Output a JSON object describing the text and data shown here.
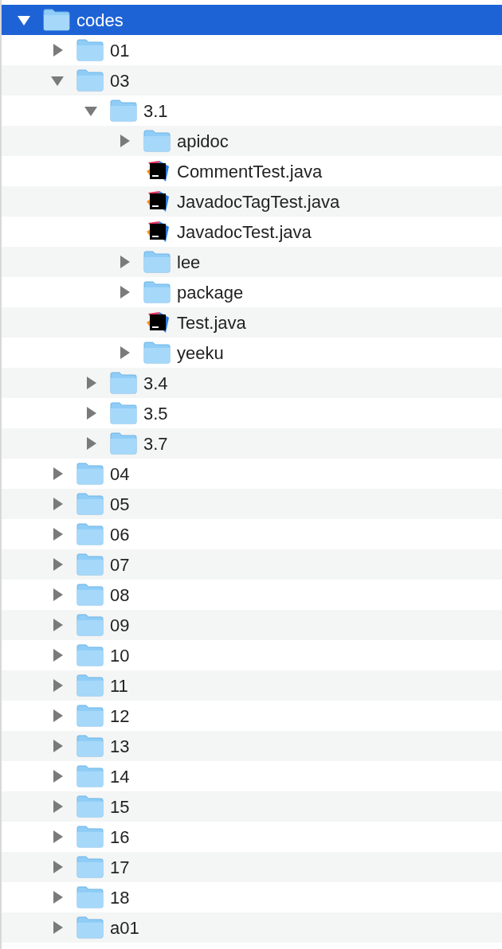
{
  "tree": [
    {
      "name": "codes",
      "kind": "folder",
      "expanded": true,
      "selected": true,
      "children": [
        {
          "name": "01",
          "kind": "folder",
          "expanded": false,
          "selected": false
        },
        {
          "name": "03",
          "kind": "folder",
          "expanded": true,
          "selected": false,
          "children": [
            {
              "name": "3.1",
              "kind": "folder",
              "expanded": true,
              "selected": false,
              "children": [
                {
                  "name": "apidoc",
                  "kind": "folder",
                  "expanded": false,
                  "selected": false
                },
                {
                  "name": "CommentTest.java",
                  "kind": "file",
                  "selected": false
                },
                {
                  "name": "JavadocTagTest.java",
                  "kind": "file",
                  "selected": false
                },
                {
                  "name": "JavadocTest.java",
                  "kind": "file",
                  "selected": false
                },
                {
                  "name": "lee",
                  "kind": "folder",
                  "expanded": false,
                  "selected": false
                },
                {
                  "name": "package",
                  "kind": "folder",
                  "expanded": false,
                  "selected": false
                },
                {
                  "name": "Test.java",
                  "kind": "file",
                  "selected": false
                },
                {
                  "name": "yeeku",
                  "kind": "folder",
                  "expanded": false,
                  "selected": false
                }
              ]
            },
            {
              "name": "3.4",
              "kind": "folder",
              "expanded": false,
              "selected": false
            },
            {
              "name": "3.5",
              "kind": "folder",
              "expanded": false,
              "selected": false
            },
            {
              "name": "3.7",
              "kind": "folder",
              "expanded": false,
              "selected": false
            }
          ]
        },
        {
          "name": "04",
          "kind": "folder",
          "expanded": false,
          "selected": false
        },
        {
          "name": "05",
          "kind": "folder",
          "expanded": false,
          "selected": false
        },
        {
          "name": "06",
          "kind": "folder",
          "expanded": false,
          "selected": false
        },
        {
          "name": "07",
          "kind": "folder",
          "expanded": false,
          "selected": false
        },
        {
          "name": "08",
          "kind": "folder",
          "expanded": false,
          "selected": false
        },
        {
          "name": "09",
          "kind": "folder",
          "expanded": false,
          "selected": false
        },
        {
          "name": "10",
          "kind": "folder",
          "expanded": false,
          "selected": false
        },
        {
          "name": "11",
          "kind": "folder",
          "expanded": false,
          "selected": false
        },
        {
          "name": "12",
          "kind": "folder",
          "expanded": false,
          "selected": false
        },
        {
          "name": "13",
          "kind": "folder",
          "expanded": false,
          "selected": false
        },
        {
          "name": "14",
          "kind": "folder",
          "expanded": false,
          "selected": false
        },
        {
          "name": "15",
          "kind": "folder",
          "expanded": false,
          "selected": false
        },
        {
          "name": "16",
          "kind": "folder",
          "expanded": false,
          "selected": false
        },
        {
          "name": "17",
          "kind": "folder",
          "expanded": false,
          "selected": false
        },
        {
          "name": "18",
          "kind": "folder",
          "expanded": false,
          "selected": false
        },
        {
          "name": "a01",
          "kind": "folder",
          "expanded": false,
          "selected": false
        }
      ]
    }
  ]
}
